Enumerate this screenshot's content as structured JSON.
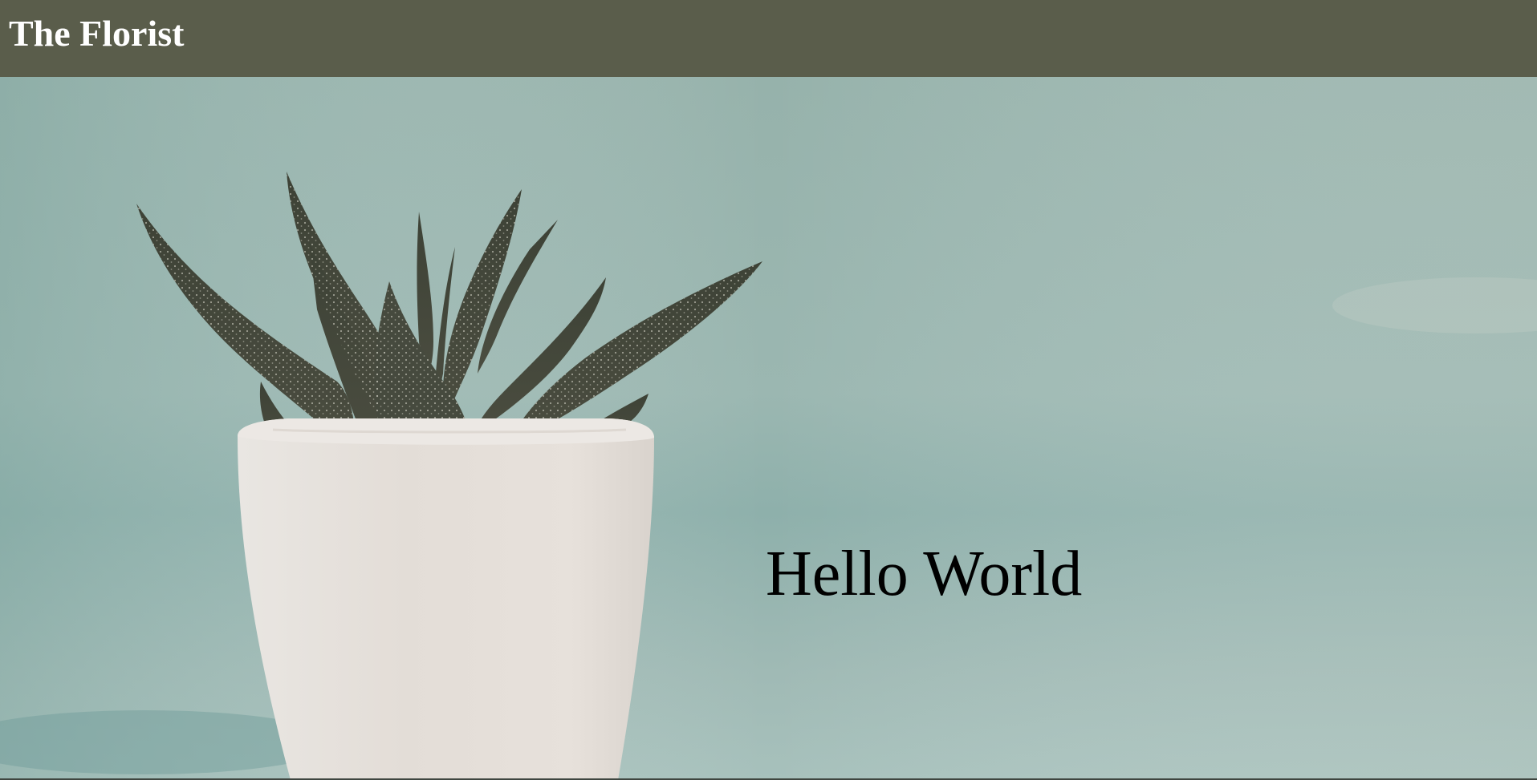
{
  "header": {
    "brand": "The Florist"
  },
  "hero": {
    "image": "succulent-in-white-pot",
    "heading": "Hello World"
  },
  "colors": {
    "header_bg": "#5a5d4b",
    "header_text": "#ffffff",
    "backdrop": "#95b4ae",
    "pot": "#e6e0da",
    "leaf": "#45473d",
    "heading_text": "#000000"
  }
}
